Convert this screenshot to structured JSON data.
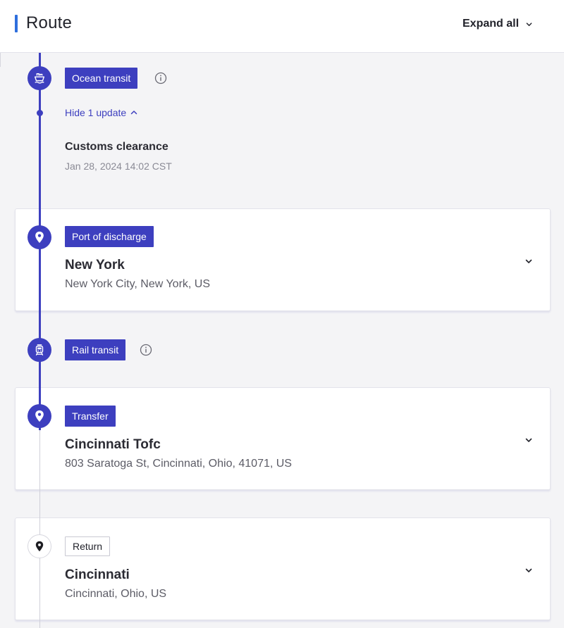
{
  "header": {
    "title": "Route",
    "expand_label": "Expand all"
  },
  "colors": {
    "primary": "#3d3fbf",
    "accent": "#2f6fdd",
    "muted_line": "#cfcfd8"
  },
  "ocean": {
    "tag": "Ocean transit",
    "toggle_label": "Hide 1 update",
    "update_title": "Customs clearance",
    "update_time": "Jan 28, 2024 14:02 CST"
  },
  "stops": [
    {
      "tag": "Port of discharge",
      "name": "New York",
      "address": "New York City, New York, US",
      "icon": "location-pin-icon"
    },
    {
      "tag": "Transfer",
      "name": "Cincinnati Tofc",
      "address": "803 Saratoga St, Cincinnati, Ohio, 41071, US",
      "icon": "location-pin-icon"
    },
    {
      "tag": "Return",
      "name": "Cincinnati",
      "address": "Cincinnati, Ohio, US",
      "icon": "location-pin-icon"
    }
  ],
  "rail": {
    "tag": "Rail transit",
    "icon": "train-icon"
  }
}
